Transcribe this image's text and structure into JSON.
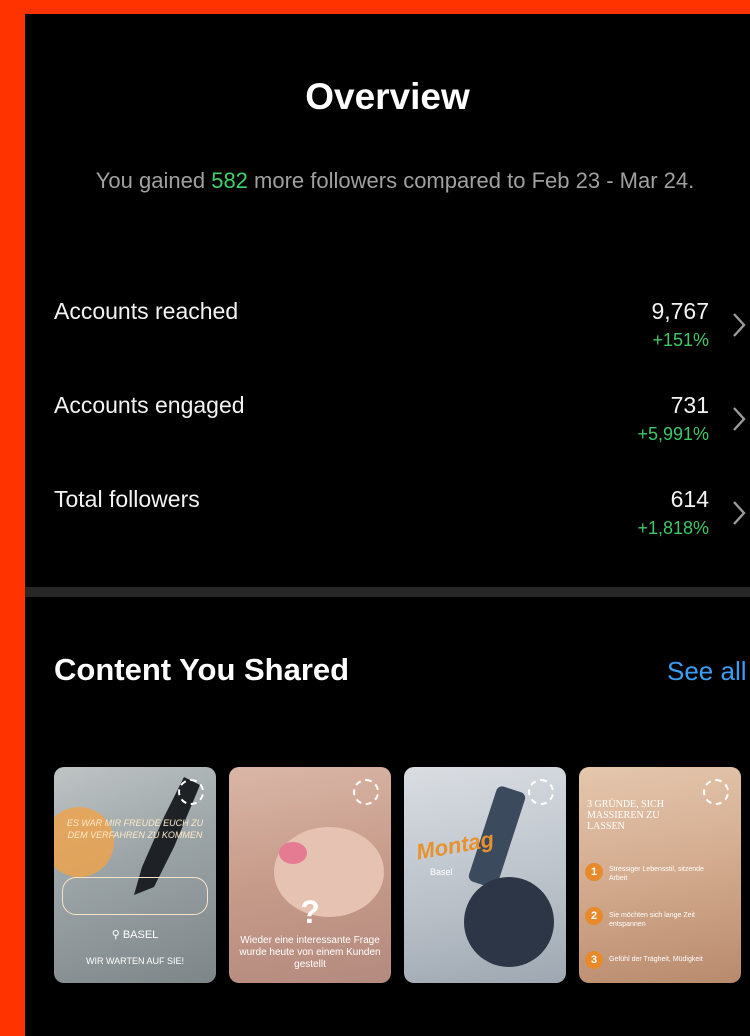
{
  "overview": {
    "title": "Overview",
    "subtitle_pre": "You gained ",
    "subtitle_highlight": "582",
    "subtitle_post": " more followers compared to Feb 23 - Mar 24."
  },
  "metrics": [
    {
      "label": "Accounts reached",
      "value": "9,767",
      "change": "+151%"
    },
    {
      "label": "Accounts engaged",
      "value": "731",
      "change": "+5,991%"
    },
    {
      "label": "Total followers",
      "value": "614",
      "change": "+1,818%"
    }
  ],
  "content": {
    "title": "Content You Shared",
    "see_all": "See all",
    "posts": [
      {
        "headline": "ES WAR MIR FREUDE EUCH ZU DEM VERFAHREN ZU KOMMEN",
        "location": "BASEL",
        "footer": "WIR WARTEN AUF SIE!"
      },
      {
        "caption": "Wieder eine interessante Frage wurde heute von einem Kunden gestellt",
        "mark": "?"
      },
      {
        "script": "Montag",
        "tag": "Basel"
      },
      {
        "headline": "3 GRÜNDE, SICH MASSIEREN ZU LASSEN",
        "steps": [
          "Stressiger Lebensstil, sitzende Arbeit",
          "Sie möchten sich lange Zeit entspannen",
          "Gefühl der Trägheit, Müdigkeit"
        ]
      }
    ]
  },
  "colors": {
    "background": "#000000",
    "frame": "#ff3300",
    "accent_green": "#3fc767",
    "link_blue": "#3b9df2"
  }
}
